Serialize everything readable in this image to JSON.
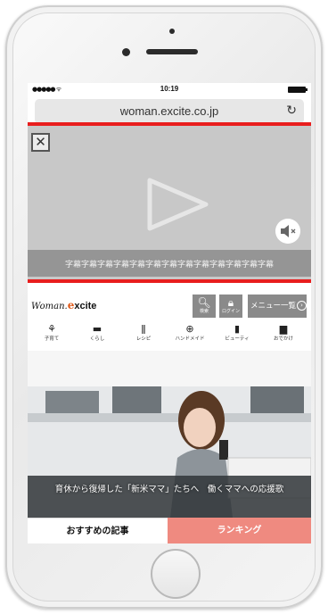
{
  "browser": {
    "status_time": "10:19",
    "signal": "●●●●● ᯤ",
    "url": "woman.excite.co.jp",
    "reload_icon": "reload-icon"
  },
  "video_ad": {
    "close_glyph": "✕",
    "subtitle": "字幕字幕字幕字幕字幕字幕字幕字幕字幕字幕字幕字幕字幕",
    "mute_icon": "speaker-muted-icon"
  },
  "site_header": {
    "logo_prefix": "Woman.",
    "logo_e": "e",
    "logo_suffix": "xcite",
    "search_label": "検索",
    "login_label": "ログイン",
    "menu_label": "メニュー一覧"
  },
  "categories": [
    {
      "icon": "sprout-icon",
      "label": "子育て"
    },
    {
      "icon": "sofa-icon",
      "label": "くらし"
    },
    {
      "icon": "utensils-icon",
      "label": "レシピ"
    },
    {
      "icon": "yarn-icon",
      "label": "ハンドメイド"
    },
    {
      "icon": "bottle-icon",
      "label": "ビューティ"
    },
    {
      "icon": "car-icon",
      "label": "おでかけ"
    }
  ],
  "hero": {
    "caption": "育休から復帰した「新米ママ」たちへ　働くママへの応援歌"
  },
  "tabs": {
    "recommend": "おすすめの記事",
    "ranking": "ランキング"
  },
  "colors": {
    "highlight": "#e81d1d",
    "ranking_tab": "#ef8a80",
    "logo_accent": "#e05a1a"
  }
}
